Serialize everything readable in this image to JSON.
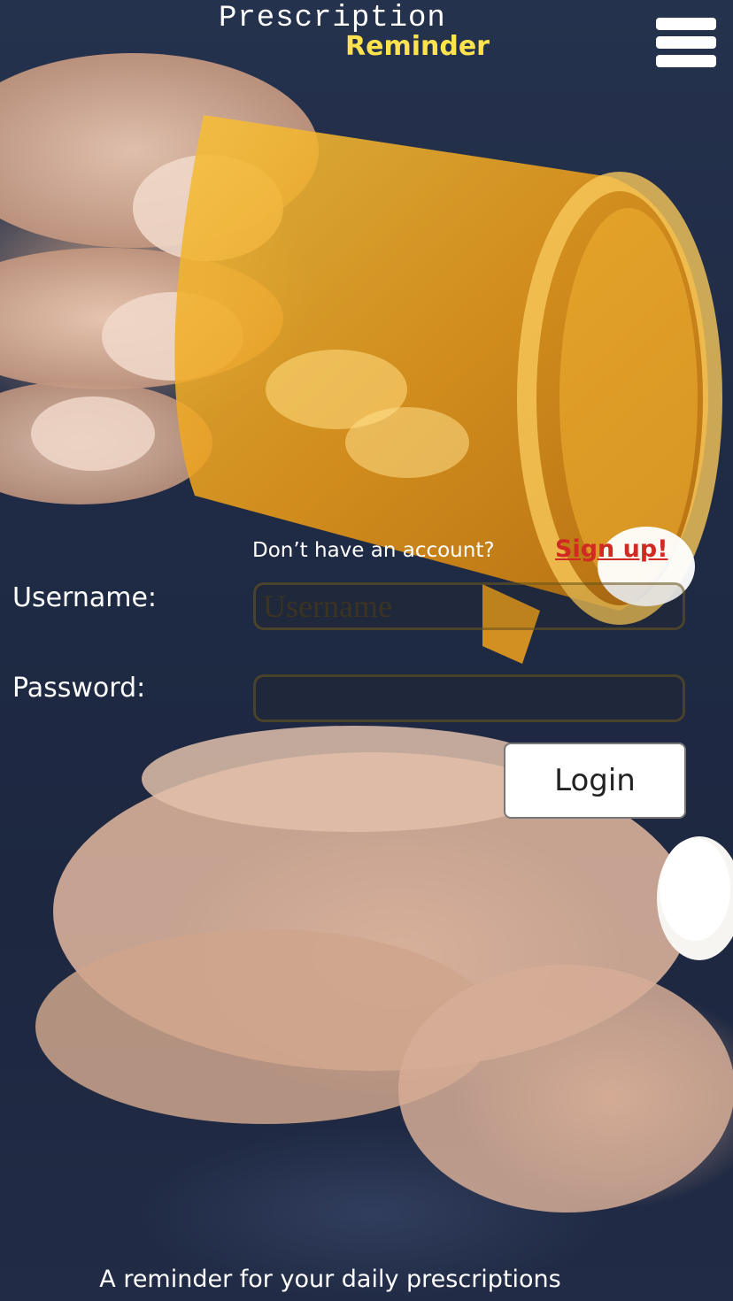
{
  "header": {
    "title_line1": "Prescription",
    "title_line2": "Reminder",
    "menu_icon": "hamburger-menu-icon"
  },
  "signup": {
    "question": "Don’t have an account?",
    "link_label": "Sign up!"
  },
  "form": {
    "username_label": "Username:",
    "username_placeholder": "Username",
    "username_value": "",
    "password_label": "Password:",
    "password_value": "",
    "login_label": "Login"
  },
  "footer": {
    "tagline": "A reminder for your daily prescriptions"
  },
  "colors": {
    "title_accent": "#ffe34d",
    "signup_link": "#d02a23",
    "pill_bottle": "#e8a11c"
  }
}
